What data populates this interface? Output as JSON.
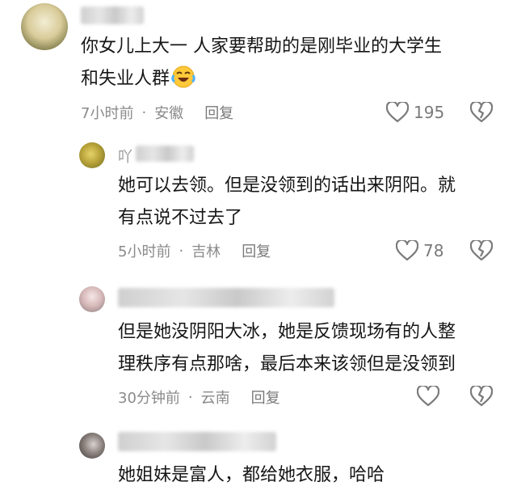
{
  "comment": {
    "line1": "你女儿上大一   人家要帮助的是刚毕业的大学生",
    "line2": "和失业人群",
    "time": "7小时前",
    "location": "安徽",
    "reply_label": "回复",
    "likes": "195"
  },
  "replies": [
    {
      "author_visible": "吖",
      "lines": [
        "她可以去领。但是没领到的话出来阴阳。就",
        "有点说不过去了"
      ],
      "time": "5小时前",
      "location": "吉林",
      "reply_label": "回复",
      "likes": "78"
    },
    {
      "lines": [
        "但是她没阴阳大冰，她是反馈现场有的人整",
        "理秩序有点那啥，最后本来该领但是没领到"
      ],
      "time": "30分钟前",
      "location": "云南",
      "reply_label": "回复",
      "likes": ""
    },
    {
      "lines": [
        "她姐妹是富人，都给她衣服，哈哈"
      ]
    }
  ],
  "colors": {
    "text": "#161616",
    "meta": "#8a8a8a",
    "icon": "#7a7a7a"
  },
  "icons": {
    "like": "heart-outline-icon",
    "dislike": "broken-heart-icon",
    "emoji": "laughing-crying-emoji"
  }
}
